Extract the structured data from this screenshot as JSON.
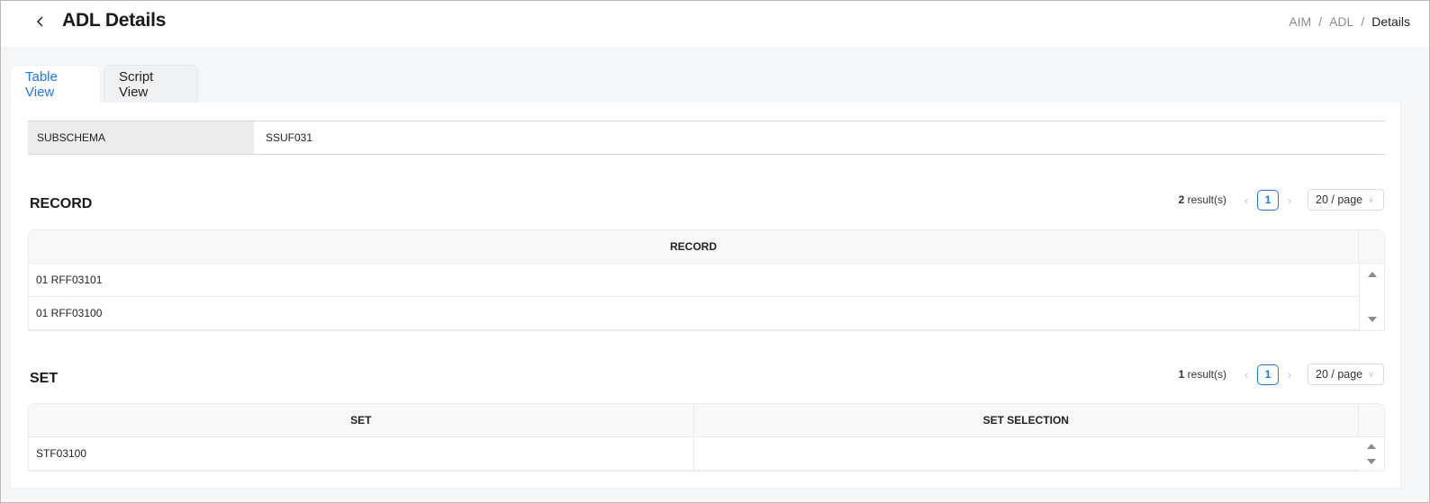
{
  "header": {
    "title": "ADL Details",
    "back_icon": "chevron-left-icon",
    "breadcrumb": [
      "AIM",
      "ADL",
      "Details"
    ]
  },
  "tabs": [
    {
      "label": "Table View",
      "active": true
    },
    {
      "label": "Script View",
      "active": false
    }
  ],
  "subschema": {
    "label": "SUBSCHEMA",
    "value": "SSUF031"
  },
  "record": {
    "title": "RECORD",
    "result_count": "2",
    "result_suffix": "result(s)",
    "current_page": "1",
    "page_size": "20 / page",
    "columns": [
      "RECORD"
    ],
    "rows": [
      [
        "01 RFF03101"
      ],
      [
        "01 RFF03100"
      ]
    ]
  },
  "set": {
    "title": "SET",
    "result_count": "1",
    "result_suffix": "result(s)",
    "current_page": "1",
    "page_size": "20 / page",
    "columns": [
      "SET",
      "SET SELECTION"
    ],
    "rows": [
      [
        "STF03100",
        ""
      ]
    ]
  },
  "colors": {
    "accent": "#1677ff",
    "header_bg": "#f8f8f8",
    "label_bg": "#ececec"
  }
}
